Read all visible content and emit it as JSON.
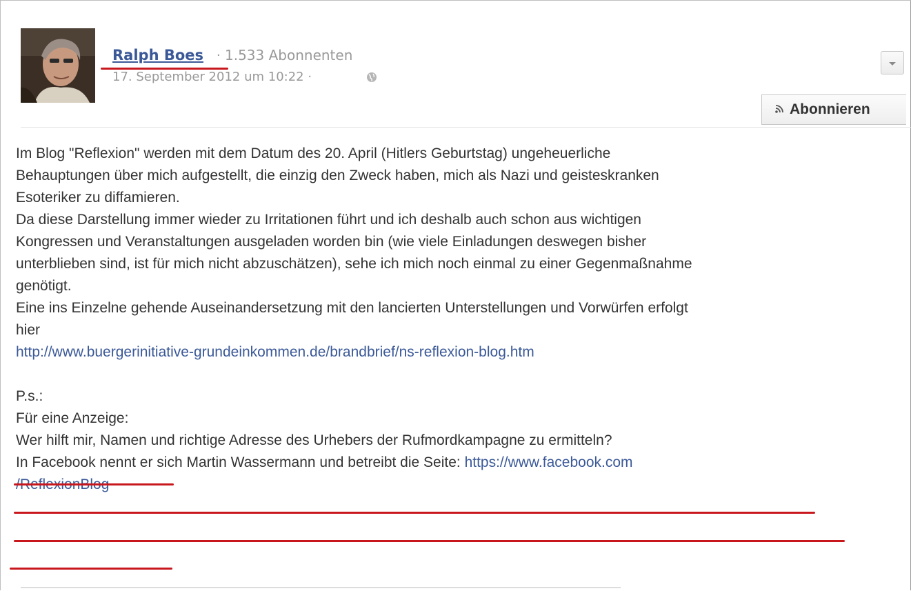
{
  "post": {
    "author_name": "Ralph Boes",
    "separator": "·",
    "subscribers": "1.533 Abonnenten",
    "date": "17. September 2012 um 10:22 ·",
    "subscribe_label": "Abonnieren",
    "lines": [
      "Im Blog \"Reflexion\" werden mit dem Datum des 20. April (Hitlers Geburtstag) ungeheuerliche",
      "Behauptungen über mich aufgestellt, die einzig den Zweck haben, mich als Nazi und geisteskranken",
      "Esoteriker zu diffamieren.",
      "Da diese Darstellung immer wieder zu Irritationen führt und ich deshalb auch schon aus wichtigen",
      "Kongressen und Veranstaltungen ausgeladen worden bin (wie viele Einladungen deswegen bisher",
      "unterblieben sind, ist für mich nicht abzuschätzen), sehe ich mich noch einmal zu einer Gegenmaßnahme",
      "genötigt.",
      "Eine ins Einzelne gehende Auseinandersetzung mit den lancierten Unterstellungen und Vorwürfen erfolgt",
      "hier"
    ],
    "link1": "http://www.buergerinitiative-grundeinkommen.de/brandbrief/ns-reflexion-blog.htm",
    "ps": "P.s.:",
    "ps_line1": "Für eine Anzeige:",
    "ps_line2": "Wer hilft mir, Namen und richtige Adresse des Urhebers der Rufmordkampagne zu ermitteln?",
    "ps_line3_text": "In Facebook nennt er sich Martin Wassermann und betreibt die Seite: ",
    "ps_line3_link": "https://www.facebook.com",
    "ps_line4_link": "/ReflexionBlog"
  },
  "colors": {
    "link": "#3b5998",
    "annotation_red": "#c8181e",
    "meta_gray": "#999999"
  },
  "icons": [
    "globe-icon",
    "chevron-down-icon",
    "rss-icon"
  ]
}
